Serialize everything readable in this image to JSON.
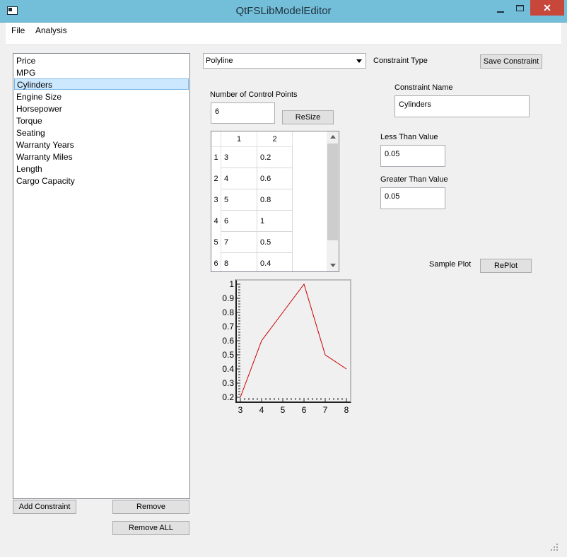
{
  "window": {
    "title": "QtFSLibModelEditor"
  },
  "menu": [
    "File",
    "Analysis"
  ],
  "constraints": [
    "Price",
    "MPG",
    "Cylinders",
    "Engine Size",
    "Horsepower",
    "Torque",
    "Seating",
    "Warranty Years",
    "Warranty Miles",
    "Length",
    "Cargo Capacity"
  ],
  "selected_index": 2,
  "buttons": {
    "add_constraint": "Add Constraint",
    "remove": "Remove",
    "remove_all": "Remove ALL",
    "save_constraint": "Save Constraint",
    "resize": "ReSize",
    "replot": "RePlot"
  },
  "constraint_type": {
    "value": "Polyline",
    "label": "Constraint Type"
  },
  "control_points": {
    "label": "Number of Control Points",
    "value": "6"
  },
  "constraint_name": {
    "label": "Constraint Name",
    "value": "Cylinders"
  },
  "less_than": {
    "label": "Less Than Value",
    "value": "0.05"
  },
  "greater_than": {
    "label": "Greater Than Value",
    "value": "0.05"
  },
  "sample_plot_label": "Sample Plot",
  "table": {
    "columns": [
      "1",
      "2"
    ],
    "rows": [
      [
        "3",
        "0.2"
      ],
      [
        "4",
        "0.6"
      ],
      [
        "5",
        "0.8"
      ],
      [
        "6",
        "1"
      ],
      [
        "7",
        "0.5"
      ],
      [
        "8",
        "0.4"
      ]
    ]
  },
  "chart_data": {
    "type": "line",
    "x": [
      3,
      4,
      5,
      6,
      7,
      8
    ],
    "series": [
      {
        "values": [
          0.2,
          0.6,
          0.8,
          1,
          0.5,
          0.4
        ],
        "color": "#cc0000"
      }
    ],
    "xlim": [
      3,
      8
    ],
    "ylim": [
      0.2,
      1
    ],
    "xticks": [
      "3",
      "4",
      "5",
      "6",
      "7",
      "8"
    ],
    "yticks": [
      "1",
      "0.9",
      "0.8",
      "0.7",
      "0.6",
      "0.5",
      "0.4",
      "0.3",
      "0.2"
    ],
    "grid": false
  },
  "colors": {
    "titlebar": "#73bfd9",
    "close": "#c7473b",
    "selection": "#cce8ff",
    "line": "#cc0000"
  }
}
